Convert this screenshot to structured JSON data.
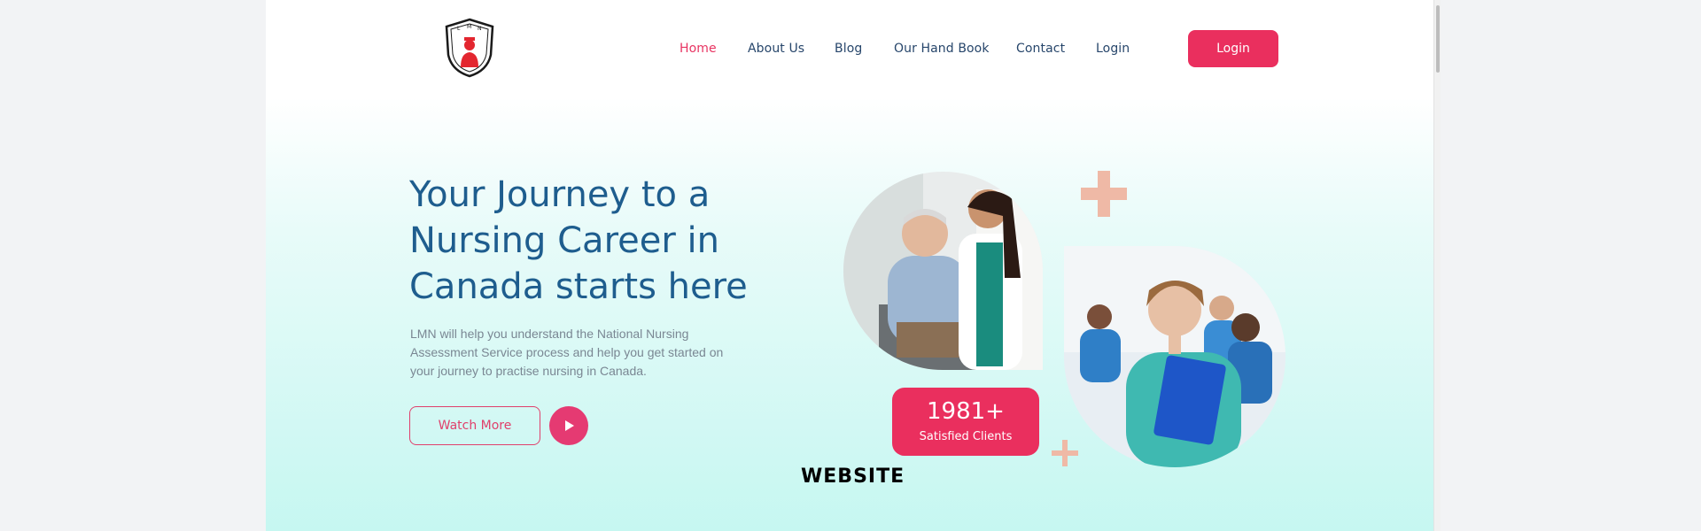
{
  "brand": {
    "logo_ring_text": "LIMITLESS MIGRATE NURSE",
    "logo_top_letters": "L M N"
  },
  "nav": {
    "items": [
      {
        "label": "Home",
        "active": true
      },
      {
        "label": "About Us",
        "active": false
      },
      {
        "label": "Blog",
        "active": false
      },
      {
        "label": "Our Hand Book",
        "active": false
      },
      {
        "label": "Contact",
        "active": false
      },
      {
        "label": "Login",
        "active": false
      }
    ],
    "login_button": "Login"
  },
  "hero": {
    "title_lines": [
      "Your Journey to a",
      "Nursing Career in",
      "Canada starts here"
    ],
    "description": "LMN will help you understand the National Nursing Assessment Service process and help you get started on your journey to practise nursing in Canada.",
    "watch_button": "Watch More"
  },
  "stats": {
    "number": "1981+",
    "label": "Satisfied Clients"
  },
  "watermark": "WEBSITE",
  "colors": {
    "accent": "#ea2f5e",
    "heading": "#1e5d8e",
    "nav_text": "#27466b",
    "plus": "#efb9a6"
  },
  "icons": [
    "logo-shield-icon",
    "play-icon",
    "plus-icon"
  ]
}
